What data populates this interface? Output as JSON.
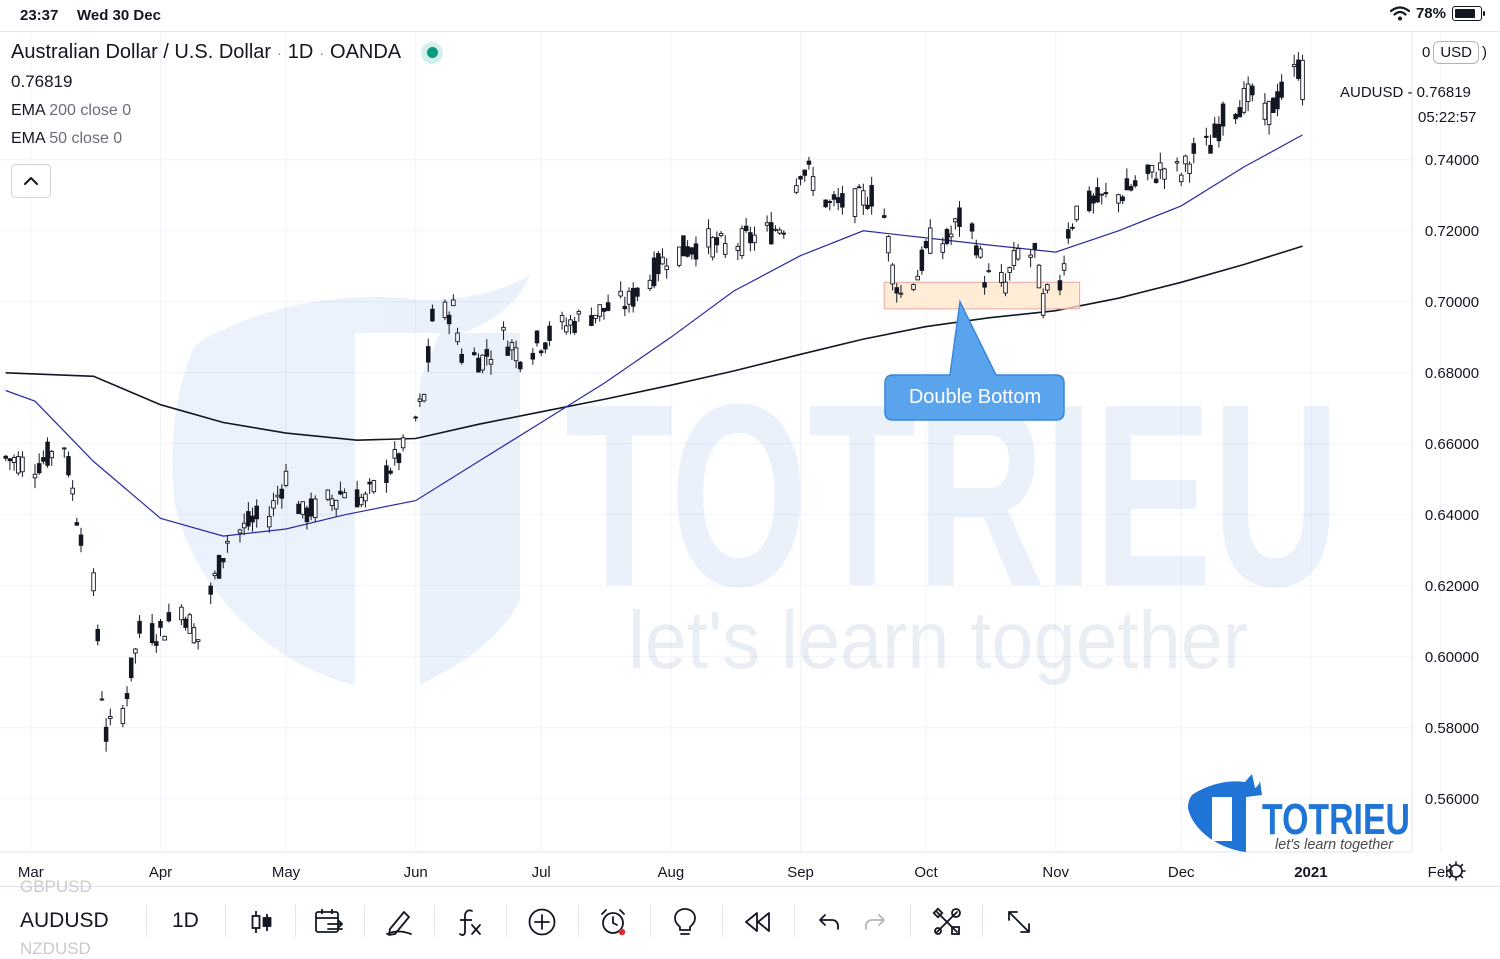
{
  "status_bar": {
    "time": "23:37",
    "date": "Wed 30 Dec",
    "battery": "78%"
  },
  "legend": {
    "title": "Australian Dollar / U.S. Dollar",
    "interval": "1D",
    "source": "OANDA",
    "price": "0.76819",
    "indicators": [
      {
        "name": "EMA",
        "params": "200 close 0",
        "color": "#131722"
      },
      {
        "name": "EMA",
        "params": "50 close 0",
        "color": "#2b2aa0"
      }
    ]
  },
  "price_scale": {
    "zero_label": "0",
    "currency": "USD",
    "ticker_label": "AUDUSD  -  0.76819",
    "countdown": "05:22:57"
  },
  "annotation": {
    "text": "Double Bottom"
  },
  "watermark": {
    "brand": "TOTRIEU",
    "tagline": "let's learn together"
  },
  "logo": {
    "brand": "TOTRIEU",
    "tagline": "let's learn together"
  },
  "bottom_bar": {
    "symbol": "AUDUSD",
    "prev_symbol": "GBPUSD",
    "next_symbol": "NZDUSD",
    "interval": "1D",
    "tools": [
      "candles-icon",
      "compare-icon",
      "draw-icon",
      "indicators-icon",
      "add-icon",
      "alert-icon",
      "ideas-icon",
      "replay-icon",
      "undo-icon",
      "redo-icon",
      "settings-tools-icon",
      "fullscreen-icon"
    ]
  },
  "chart_data": {
    "type": "candlestick",
    "symbol": "AUDUSD",
    "x_labels": [
      "Mar",
      "Apr",
      "May",
      "Jun",
      "Jul",
      "Aug",
      "Sep",
      "Oct",
      "Nov",
      "Dec",
      "2021",
      "Feb"
    ],
    "y_ticks": [
      "0.56000",
      "0.58000",
      "0.60000",
      "0.62000",
      "0.64000",
      "0.66000",
      "0.68000",
      "0.70000",
      "0.72000",
      "0.74000"
    ],
    "ylim": [
      0.545,
      0.776
    ],
    "grid": true,
    "last_price": 0.76819,
    "close_anchors": [
      [
        "Feb 24",
        0.656
      ],
      [
        "Mar 2",
        0.654
      ],
      [
        "Mar 9",
        0.66
      ],
      [
        "Mar 12",
        0.64
      ],
      [
        "Mar 16",
        0.62
      ],
      [
        "Mar 18",
        0.59
      ],
      [
        "Mar 19",
        0.578
      ],
      [
        "Mar 23",
        0.585
      ],
      [
        "Mar 27",
        0.607
      ],
      [
        "Apr 1",
        0.607
      ],
      [
        "Apr 6",
        0.614
      ],
      [
        "Apr 10",
        0.605
      ],
      [
        "Apr 13",
        0.618
      ],
      [
        "Apr 17",
        0.633
      ],
      [
        "Apr 23",
        0.638
      ],
      [
        "Apr 27",
        0.64
      ],
      [
        "May 1",
        0.651
      ],
      [
        "May 5",
        0.64
      ],
      [
        "May 10",
        0.643
      ],
      [
        "May 15",
        0.647
      ],
      [
        "May 20",
        0.644
      ],
      [
        "May 25",
        0.652
      ],
      [
        "May 29",
        0.658
      ],
      [
        "Jun 3",
        0.673
      ],
      [
        "Jun 5",
        0.695
      ],
      [
        "Jun 10",
        0.698
      ],
      [
        "Jun 12",
        0.685
      ],
      [
        "Jun 17",
        0.684
      ],
      [
        "Jun 22",
        0.69
      ],
      [
        "Jun 26",
        0.685
      ],
      [
        "Jul 1",
        0.689
      ],
      [
        "Jul 6",
        0.693
      ],
      [
        "Jul 14",
        0.697
      ],
      [
        "Jul 22",
        0.7
      ],
      [
        "Jul 27",
        0.707
      ],
      [
        "Jul 31",
        0.713
      ],
      [
        "Aug 5",
        0.715
      ],
      [
        "Aug 10",
        0.717
      ],
      [
        "Aug 14",
        0.715
      ],
      [
        "Aug 18",
        0.717
      ],
      [
        "Aug 25",
        0.72
      ],
      [
        "Aug 28",
        0.722
      ],
      [
        "Sep 1",
        0.738
      ],
      [
        "Sep 3",
        0.736
      ],
      [
        "Sep 8",
        0.727
      ],
      [
        "Sep 14",
        0.728
      ],
      [
        "Sep 18",
        0.73
      ],
      [
        "Sep 21",
        0.724
      ],
      [
        "Sep 23",
        0.709
      ],
      [
        "Sep 25",
        0.702
      ],
      [
        "Sep 29",
        0.708
      ],
      [
        "Oct 2",
        0.717
      ],
      [
        "Oct 6",
        0.717
      ],
      [
        "Oct 9",
        0.723
      ],
      [
        "Oct 13",
        0.717
      ],
      [
        "Oct 15",
        0.707
      ],
      [
        "Oct 20",
        0.705
      ],
      [
        "Oct 23",
        0.714
      ],
      [
        "Oct 27",
        0.713
      ],
      [
        "Oct 29",
        0.7
      ],
      [
        "Nov 2",
        0.705
      ],
      [
        "Nov 4",
        0.72
      ],
      [
        "Nov 6",
        0.726
      ],
      [
        "Nov 10",
        0.728
      ],
      [
        "Nov 16",
        0.73
      ],
      [
        "Nov 23",
        0.735
      ],
      [
        "Nov 27",
        0.738
      ],
      [
        "Dec 1",
        0.736
      ],
      [
        "Dec 4",
        0.742
      ],
      [
        "Dec 8",
        0.744
      ],
      [
        "Dec 11",
        0.752
      ],
      [
        "Dec 16",
        0.757
      ],
      [
        "Dec 18",
        0.758
      ],
      [
        "Dec 21",
        0.752
      ],
      [
        "Dec 24",
        0.757
      ],
      [
        "Dec 30",
        0.768
      ]
    ],
    "series": [
      {
        "name": "EMA 200 close 0",
        "color": "#131722",
        "points": [
          [
            "Feb 24",
            0.68
          ],
          [
            "Mar 16",
            0.679
          ],
          [
            "Apr 1",
            0.671
          ],
          [
            "Apr 16",
            0.666
          ],
          [
            "May 1",
            0.663
          ],
          [
            "May 18",
            0.661
          ],
          [
            "Jun 1",
            0.6615
          ],
          [
            "Jun 16",
            0.6655
          ],
          [
            "Jul 1",
            0.669
          ],
          [
            "Jul 16",
            0.6725
          ],
          [
            "Aug 1",
            0.6765
          ],
          [
            "Aug 16",
            0.6805
          ],
          [
            "Sep 1",
            0.6852
          ],
          [
            "Sep 16",
            0.6895
          ],
          [
            "Oct 1",
            0.693
          ],
          [
            "Oct 16",
            0.6955
          ],
          [
            "Nov 1",
            0.6975
          ],
          [
            "Nov 16",
            0.701
          ],
          [
            "Dec 1",
            0.7055
          ],
          [
            "Dec 16",
            0.7105
          ],
          [
            "Dec 30",
            0.7157
          ]
        ]
      },
      {
        "name": "EMA 50 close 0",
        "color": "#2b2aa0",
        "points": [
          [
            "Feb 24",
            0.675
          ],
          [
            "Mar 2",
            0.672
          ],
          [
            "Mar 16",
            0.655
          ],
          [
            "Apr 1",
            0.639
          ],
          [
            "Apr 16",
            0.634
          ],
          [
            "May 1",
            0.636
          ],
          [
            "May 15",
            0.64
          ],
          [
            "Jun 1",
            0.644
          ],
          [
            "Jun 16",
            0.655
          ],
          [
            "Jul 1",
            0.666
          ],
          [
            "Jul 16",
            0.677
          ],
          [
            "Aug 1",
            0.69
          ],
          [
            "Aug 16",
            0.703
          ],
          [
            "Sep 1",
            0.713
          ],
          [
            "Sep 16",
            0.72
          ],
          [
            "Oct 1",
            0.718
          ],
          [
            "Oct 16",
            0.716
          ],
          [
            "Nov 1",
            0.714
          ],
          [
            "Nov 16",
            0.72
          ],
          [
            "Dec 1",
            0.727
          ],
          [
            "Dec 16",
            0.738
          ],
          [
            "Dec 30",
            0.747
          ]
        ]
      }
    ],
    "annotation_zone": {
      "from": "Sep 21",
      "to": "Nov 6",
      "price_low": 0.698,
      "price_high": 0.7055,
      "label": "Double Bottom"
    }
  }
}
